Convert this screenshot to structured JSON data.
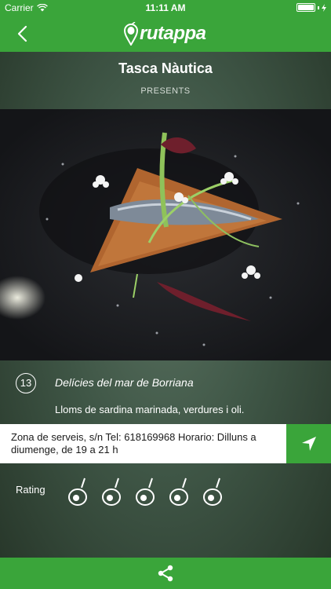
{
  "status": {
    "carrier": "Carrier",
    "time": "11:11 AM"
  },
  "nav": {
    "logo_text": "rutappa"
  },
  "restaurant": {
    "name": "Tasca Nàutica",
    "presents": "PRESENTS"
  },
  "dish": {
    "number": "13",
    "name": "Delícies del mar de Borriana",
    "description": "Lloms de sardina marinada, verdures i oli."
  },
  "address": {
    "text": "Zona de serveis, s/n Tel: 618169968 Horario: Dilluns a diumenge, de 19 a 21 h"
  },
  "rating": {
    "label": "Rating",
    "value": 0,
    "max": 5
  },
  "icons": {
    "back": "chevron-left-icon",
    "navigate": "location-arrow-icon",
    "share": "share-icon",
    "wifi": "wifi-icon",
    "battery": "battery-icon"
  },
  "colors": {
    "brand": "#3aa53a"
  }
}
